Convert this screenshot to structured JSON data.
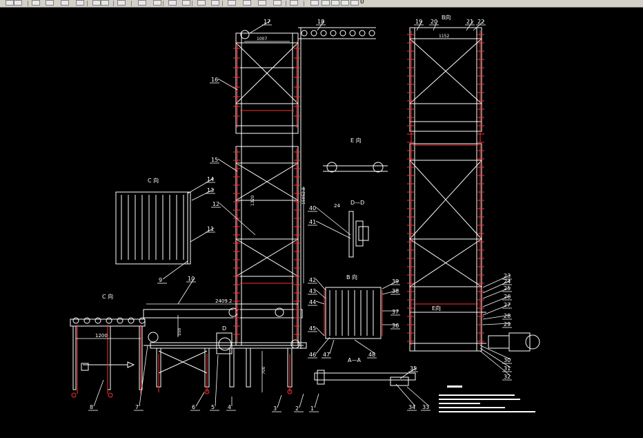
{
  "toolbar": {
    "buttons": [
      "save-icon",
      "undo-icon",
      "redo-icon",
      "layer-icon",
      "pan-icon",
      "properties-icon",
      "match-icon",
      "pencil-icon",
      "pick-icon",
      "arrow-down-icon",
      "arrow-down-gray-icon",
      "paint-icon",
      "zoom-realtime-icon",
      "zoom-window-icon",
      "zoom-previous-icon",
      "dimension-icon",
      "table-icon",
      "toolpalette-icon",
      "grid-icon",
      "help-icon",
      "layers-icon",
      "bulb-icon",
      "sun-icon",
      "lock-icon",
      "color-box-icon"
    ],
    "layer_value": "0"
  },
  "drawing": {
    "part_numbers": [
      "1",
      "2",
      "3",
      "4",
      "5",
      "6",
      "7",
      "8",
      "9",
      "10",
      "11",
      "12",
      "13",
      "14",
      "15",
      "16",
      "17",
      "18",
      "19",
      "20",
      "21",
      "22",
      "23",
      "24",
      "25",
      "26",
      "27",
      "28",
      "29",
      "30",
      "31",
      "32",
      "33",
      "34",
      "35",
      "36",
      "37",
      "38",
      "39",
      "40",
      "41",
      "42",
      "43",
      "44",
      "45",
      "46",
      "47",
      "48"
    ],
    "view_labels": {
      "c_view_top": "C 向",
      "c_view_left": "C 向",
      "e_view": "E 向",
      "b_view": "B 向",
      "d_view": "D—D",
      "a_section": "A—A",
      "b_dir": "B向",
      "e_dir": "E向",
      "d_label": "D"
    },
    "dimensions": {
      "d1007": "1007",
      "d1152": "1152",
      "d1200": "1200",
      "d2409": "2409.2",
      "d15052": "15052.8",
      "d1320": "1320",
      "d550": "550",
      "d700": "700",
      "d24": "24"
    }
  }
}
